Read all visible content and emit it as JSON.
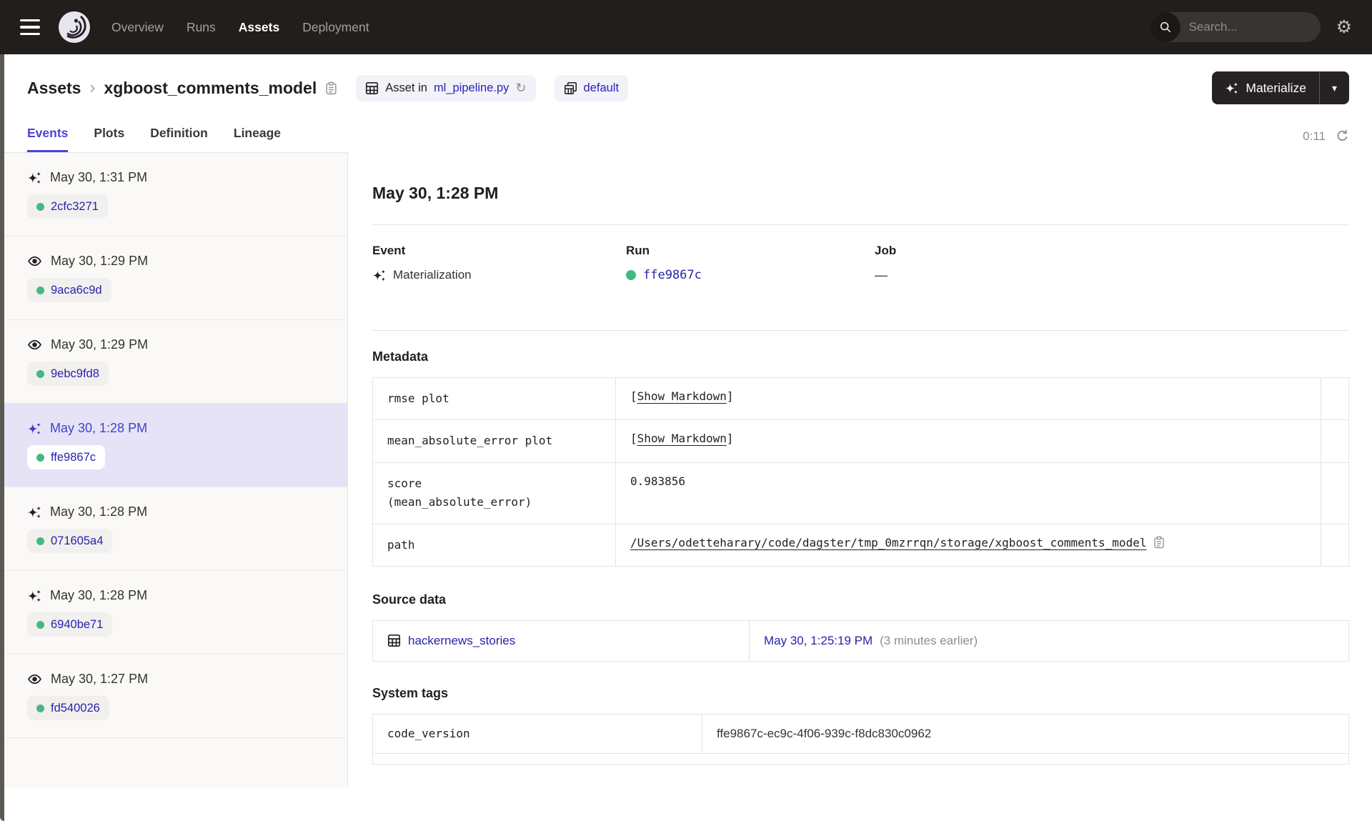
{
  "brand_colors": {
    "accent": "#4B43D6",
    "link_blue": "#2823A8",
    "success_green": "#43B981",
    "nav_background": "#211E1B",
    "selected_row": "#E6E3F7"
  },
  "nav": {
    "items": [
      {
        "label": "Overview"
      },
      {
        "label": "Runs"
      },
      {
        "label": "Assets"
      },
      {
        "label": "Deployment"
      }
    ],
    "active_item": "Assets",
    "search": {
      "placeholder": "Search...",
      "shortcut": "/"
    }
  },
  "header": {
    "breadcrumb": {
      "root": "Assets",
      "separator": "›",
      "current": "xgboost_comments_model"
    },
    "asset_location_badge": {
      "prefix": "Asset in",
      "file": "ml_pipeline.py"
    },
    "group_badge": {
      "label": "default"
    },
    "materialize": {
      "label": "Materialize",
      "caret": "▾"
    }
  },
  "tabs": {
    "items": [
      {
        "label": "Events"
      },
      {
        "label": "Plots"
      },
      {
        "label": "Definition"
      },
      {
        "label": "Lineage"
      }
    ],
    "active": "Events",
    "refresh_timer": "0:11"
  },
  "sidebar": {
    "events": [
      {
        "type": "materialization",
        "time": "May 30, 1:31 PM",
        "run_id": "2cfc3271"
      },
      {
        "type": "observation",
        "time": "May 30, 1:29 PM",
        "run_id": "9aca6c9d"
      },
      {
        "type": "observation",
        "time": "May 30, 1:29 PM",
        "run_id": "9ebc9fd8"
      },
      {
        "type": "materialization",
        "time": "May 30, 1:28 PM",
        "run_id": "ffe9867c",
        "selected": true
      },
      {
        "type": "materialization",
        "time": "May 30, 1:28 PM",
        "run_id": "071605a4"
      },
      {
        "type": "materialization",
        "time": "May 30, 1:28 PM",
        "run_id": "6940be71"
      },
      {
        "type": "observation",
        "time": "May 30, 1:27 PM",
        "run_id": "fd540026"
      }
    ]
  },
  "detail": {
    "title": "May 30, 1:28 PM",
    "summary": {
      "event_label": "Event",
      "event_value": "Materialization",
      "run_label": "Run",
      "run_id": "ffe9867c",
      "job_label": "Job",
      "job_value": "—"
    },
    "metadata": {
      "heading": "Metadata",
      "bracket_open": "[",
      "bracket_close": "]",
      "rows": [
        {
          "key": "rmse plot",
          "link": "Show Markdown"
        },
        {
          "key": "mean_absolute_error plot",
          "link": "Show Markdown"
        },
        {
          "key_line1": "score",
          "key_line2": "(mean_absolute_error)",
          "value": "0.983856"
        },
        {
          "key": "path",
          "value": "/Users/odetteharary/code/dagster/tmp_0mzrrqn/storage/xgboost_comments_model"
        }
      ]
    },
    "source_data": {
      "heading": "Source data",
      "asset": "hackernews_stories",
      "timestamp": "May 30, 1:25:19 PM",
      "note": "(3 minutes earlier)"
    },
    "system_tags": {
      "heading": "System tags",
      "rows": [
        {
          "key": "code_version",
          "value": "ffe9867c-ec9c-4f06-939c-f8dc830c0962"
        }
      ]
    }
  }
}
